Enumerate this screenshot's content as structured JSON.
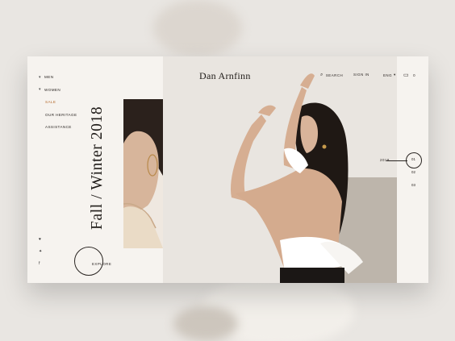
{
  "brand": "Dan  Arnfinn",
  "header": {
    "search_label": "SEARCH",
    "signin_label": "SIGN IN",
    "lang_label": "ENG",
    "cart_count": "0"
  },
  "nav": {
    "items": [
      {
        "label": "MEN",
        "caret": "▾"
      },
      {
        "label": "WOMEN",
        "caret": "▾"
      },
      {
        "label": "SALE"
      },
      {
        "label": "OUR HERITAGE"
      },
      {
        "label": "ASSISTANCE"
      }
    ]
  },
  "hero": {
    "title": "Fall  /  Winter  2018",
    "explore_label": "EXPLORE"
  },
  "social": [
    "♥",
    "✦",
    "f"
  ],
  "slider": {
    "year": "2018",
    "dots": [
      "01",
      "02",
      "03"
    ]
  },
  "colors": {
    "accent_sale": "#b56a2c",
    "panel_bg": "#f3f0ec"
  }
}
